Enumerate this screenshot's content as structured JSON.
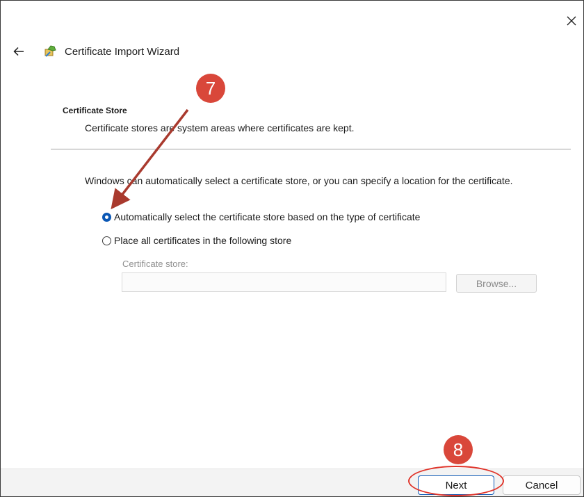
{
  "window": {
    "title": "Certificate Import Wizard",
    "icons": {
      "close": "close-icon",
      "back": "back-arrow-icon",
      "wizard": "certificate-wizard-icon"
    }
  },
  "page": {
    "heading": "Certificate Store",
    "description": "Certificate stores are system areas where certificates are kept.",
    "intro": "Windows can automatically select a certificate store, or you can specify a location for the certificate.",
    "options": [
      {
        "label": "Automatically select the certificate store based on the type of certificate",
        "checked": true
      },
      {
        "label": "Place all certificates in the following store",
        "checked": false
      }
    ],
    "store_label": "Certificate store:",
    "store_value": "",
    "browse_label": "Browse..."
  },
  "footer": {
    "next_label": "Next",
    "cancel_label": "Cancel"
  },
  "annotations": {
    "step_a": "7",
    "step_b": "8",
    "color": "#d9473a"
  },
  "colors": {
    "accent": "#0a57b5",
    "annotation_red": "#d9473a"
  }
}
